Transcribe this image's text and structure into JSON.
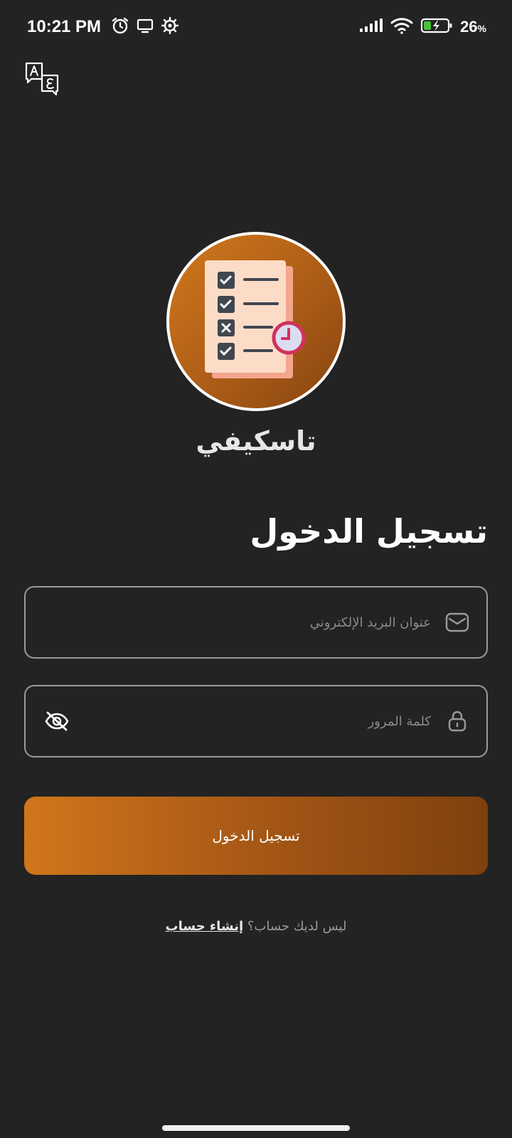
{
  "status_bar": {
    "time": "10:21 PM",
    "battery_percent": "26",
    "battery_unit": "%"
  },
  "app": {
    "name": "تاسكيفي",
    "brand_colors": [
      "#d2781d",
      "#874410"
    ]
  },
  "login": {
    "title": "تسجيل الدخول",
    "email_placeholder": "عنوان البريد الإلكتروني",
    "password_placeholder": "كلمة المرور",
    "button_label": "تسجيل الدخول",
    "no_account_text": "ليس لديك حساب؟",
    "signup_link": "إنشاء حساب"
  },
  "icons": [
    "alarm-icon",
    "screen-icon",
    "settings-icon",
    "signal-icon",
    "wifi-icon",
    "battery-charging-icon",
    "translate-icon",
    "mail-icon",
    "lock-icon",
    "eye-off-icon"
  ]
}
